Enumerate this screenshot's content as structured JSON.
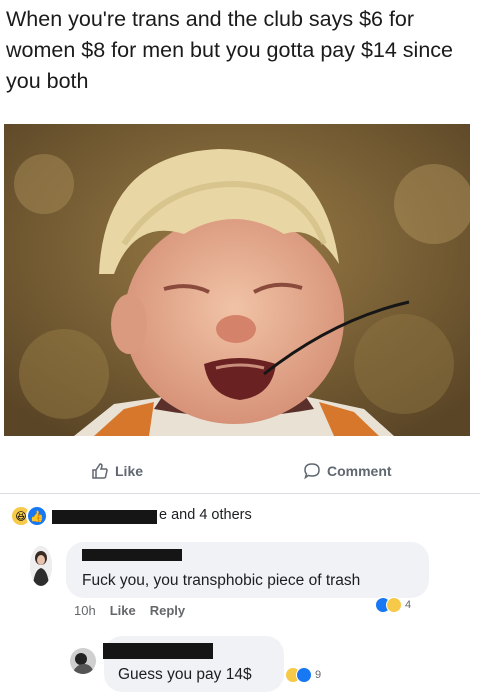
{
  "post": {
    "caption": "When you're trans and the club says $6 for women $8 for men but you gotta pay $14 since you both",
    "image_alt": "crying-child-photo"
  },
  "actions": {
    "like_label": "Like",
    "comment_label": "Comment"
  },
  "reactions": {
    "summary_suffix": "e and 4 others",
    "icons": [
      "haha-icon",
      "like-icon"
    ]
  },
  "comments": [
    {
      "text": "Fuck you, you transphobic piece of trash",
      "time": "10h",
      "like_label": "Like",
      "reply_label": "Reply",
      "reaction_count": "4"
    },
    {
      "text": "Guess you pay 14$",
      "reaction_count": "9"
    }
  ],
  "colors": {
    "like_blue": "#1877f2",
    "haha_yellow": "#f7c948",
    "bubble_gray": "#f0f2f5",
    "meta_gray": "#65676b"
  }
}
